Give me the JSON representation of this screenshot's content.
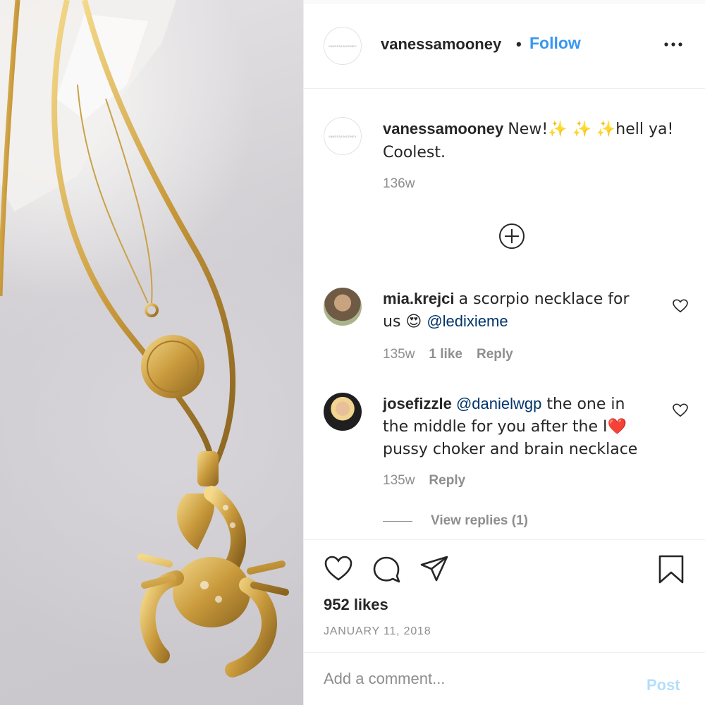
{
  "post": {
    "username": "vanessamooney",
    "follow_label": "Follow",
    "separator": "•",
    "avatar_logo_text": "VANESSA MOONEY",
    "caption": {
      "username": "vanessamooney",
      "text": "New!✨ ✨ ✨hell ya! Coolest.",
      "time": "136w"
    },
    "comments": [
      {
        "username": "mia.krejci",
        "text": "a scorpio necklace for us 😍 ",
        "mention": "@ledixieme",
        "time": "135w",
        "likes": "1 like",
        "reply_label": "Reply"
      },
      {
        "username": "josefizzle",
        "mention": "@danielwgp",
        "text": " the one in the middle for you after the I❤️ pussy choker and brain necklace",
        "time": "135w",
        "reply_label": "Reply",
        "view_replies": "View replies (1)"
      }
    ],
    "likes": "952 likes",
    "date": "JANUARY 11, 2018",
    "add_comment_placeholder": "Add a comment...",
    "post_label": "Post"
  },
  "icons": {
    "more": "more-options-icon",
    "load_more": "plus-circle-icon",
    "like": "heart-icon",
    "comment": "comment-icon",
    "share": "paper-plane-icon",
    "save": "bookmark-icon"
  },
  "colors": {
    "follow": "#3897f0",
    "post_disabled": "#b2dffc",
    "secondary_text": "#8e8e8e",
    "mention": "#003569"
  }
}
